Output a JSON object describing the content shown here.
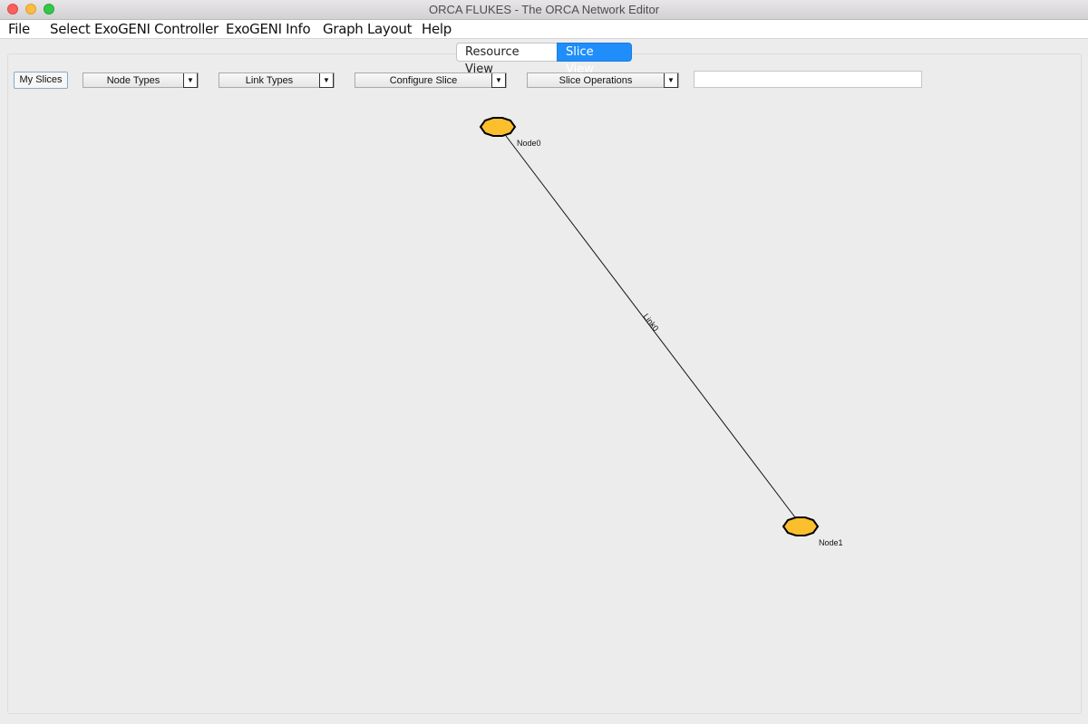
{
  "window": {
    "title": "ORCA FLUKES - The ORCA Network Editor"
  },
  "menubar": {
    "items": [
      "File",
      "Select ExoGENI Controller",
      "ExoGENI Info",
      "Graph Layout",
      "Help"
    ]
  },
  "tabs": [
    {
      "label": "Resource View",
      "active": false
    },
    {
      "label": "Slice View",
      "active": true
    }
  ],
  "toolbar": {
    "my_slices": "My Slices",
    "node_types": "Node Types",
    "link_types": "Link Types",
    "configure_slice": "Configure Slice",
    "slice_operations": "Slice Operations",
    "search_value": ""
  },
  "graph": {
    "nodes": [
      {
        "id": "node0",
        "label": "Node0",
        "color": "#fbbf2d",
        "icon": "node-diamond-icon"
      },
      {
        "id": "node1",
        "label": "Node1",
        "color": "#fbbf2d",
        "icon": "node-diamond-icon"
      }
    ],
    "links": [
      {
        "label": "Link0",
        "from": "Node0",
        "to": "Node1"
      }
    ]
  },
  "colors": {
    "accent": "#1f8efa",
    "node_fill": "#fbbf2d",
    "node_outline": "#000000"
  }
}
